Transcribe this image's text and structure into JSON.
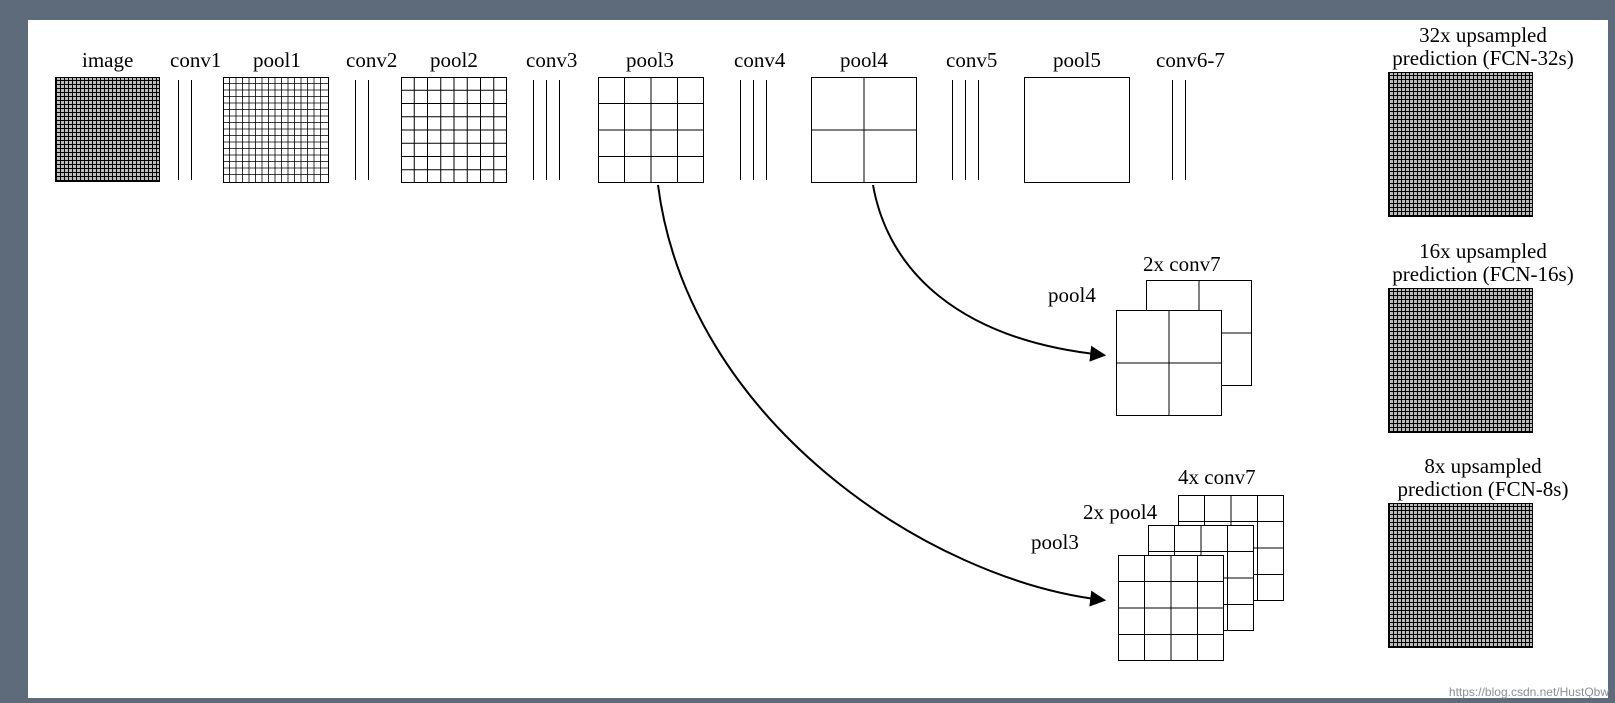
{
  "row": {
    "image": "image",
    "conv1": "conv1",
    "pool1": "pool1",
    "conv2": "conv2",
    "pool2": "pool2",
    "conv3": "conv3",
    "pool3": "pool3",
    "conv4": "conv4",
    "pool4": "pool4",
    "conv5": "conv5",
    "pool5": "pool5",
    "conv67": "conv6-7"
  },
  "out": {
    "p32a": "32x upsampled",
    "p32b": "prediction (FCN-32s)",
    "p16a": "16x upsampled",
    "p16b": "prediction (FCN-16s)",
    "p8a": "8x upsampled",
    "p8b": "prediction (FCN-8s)"
  },
  "mid": {
    "pool4": "pool4",
    "conv7x2": "2x conv7",
    "pool3": "pool3",
    "pool4x2": "2x pool4",
    "conv7x4": "4x conv7"
  },
  "watermark": "https://blog.csdn.net/HustQbw"
}
